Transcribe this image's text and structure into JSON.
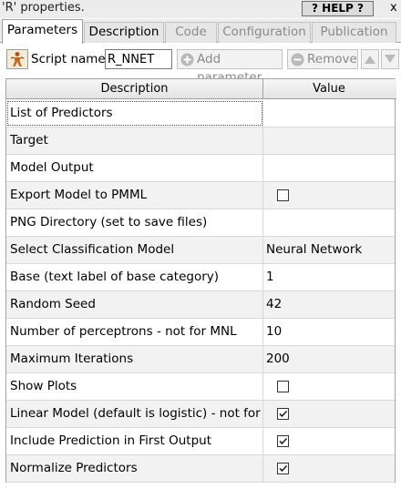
{
  "window": {
    "title": "'R' properties.",
    "help_label": "? HELP ?",
    "close_glyph": "x"
  },
  "tabs": [
    {
      "label": "Parameters",
      "active": true,
      "enabled": true
    },
    {
      "label": "Description",
      "active": false,
      "enabled": true
    },
    {
      "label": "Code",
      "active": false,
      "enabled": false
    },
    {
      "label": "Configuration",
      "active": false,
      "enabled": false
    },
    {
      "label": "Publication",
      "active": false,
      "enabled": false
    }
  ],
  "toolbar": {
    "script_icon": "script-figure-icon",
    "script_name_label": "Script name:",
    "script_name_value": "R_NNET",
    "add_parameter_label": "Add parameter",
    "add_parameter_icon": "plus-circle-icon",
    "remove_label": "Remove",
    "remove_icon": "minus-circle-icon",
    "move_up_icon": "arrow-up-icon",
    "move_down_icon": "arrow-down-icon"
  },
  "table": {
    "columns": [
      "Description",
      "Value"
    ],
    "rows": [
      {
        "description": "List of Predictors",
        "value": "",
        "type": "text"
      },
      {
        "description": "Target",
        "value": "",
        "type": "text"
      },
      {
        "description": "Model Output",
        "value": "",
        "type": "text"
      },
      {
        "description": "Export Model to PMML",
        "checked": false,
        "type": "checkbox"
      },
      {
        "description": "PNG Directory (set to save files)",
        "value": "",
        "type": "text"
      },
      {
        "description": "Select Classification Model",
        "value": "Neural Network",
        "type": "text"
      },
      {
        "description": "Base (text label of base category)",
        "value": "1",
        "type": "text"
      },
      {
        "description": "Random Seed",
        "value": "42",
        "type": "text"
      },
      {
        "description": "Number of perceptrons - not for MNL",
        "value": "10",
        "type": "text"
      },
      {
        "description": "Maximum Iterations",
        "value": "200",
        "type": "text"
      },
      {
        "description": "Show Plots",
        "checked": false,
        "type": "checkbox"
      },
      {
        "description": "Linear Model (default is logistic) - not for MNL",
        "checked": true,
        "type": "checkbox"
      },
      {
        "description": "Include Prediction in First Output",
        "checked": true,
        "type": "checkbox"
      },
      {
        "description": "Normalize Predictors",
        "checked": true,
        "type": "checkbox"
      }
    ]
  }
}
